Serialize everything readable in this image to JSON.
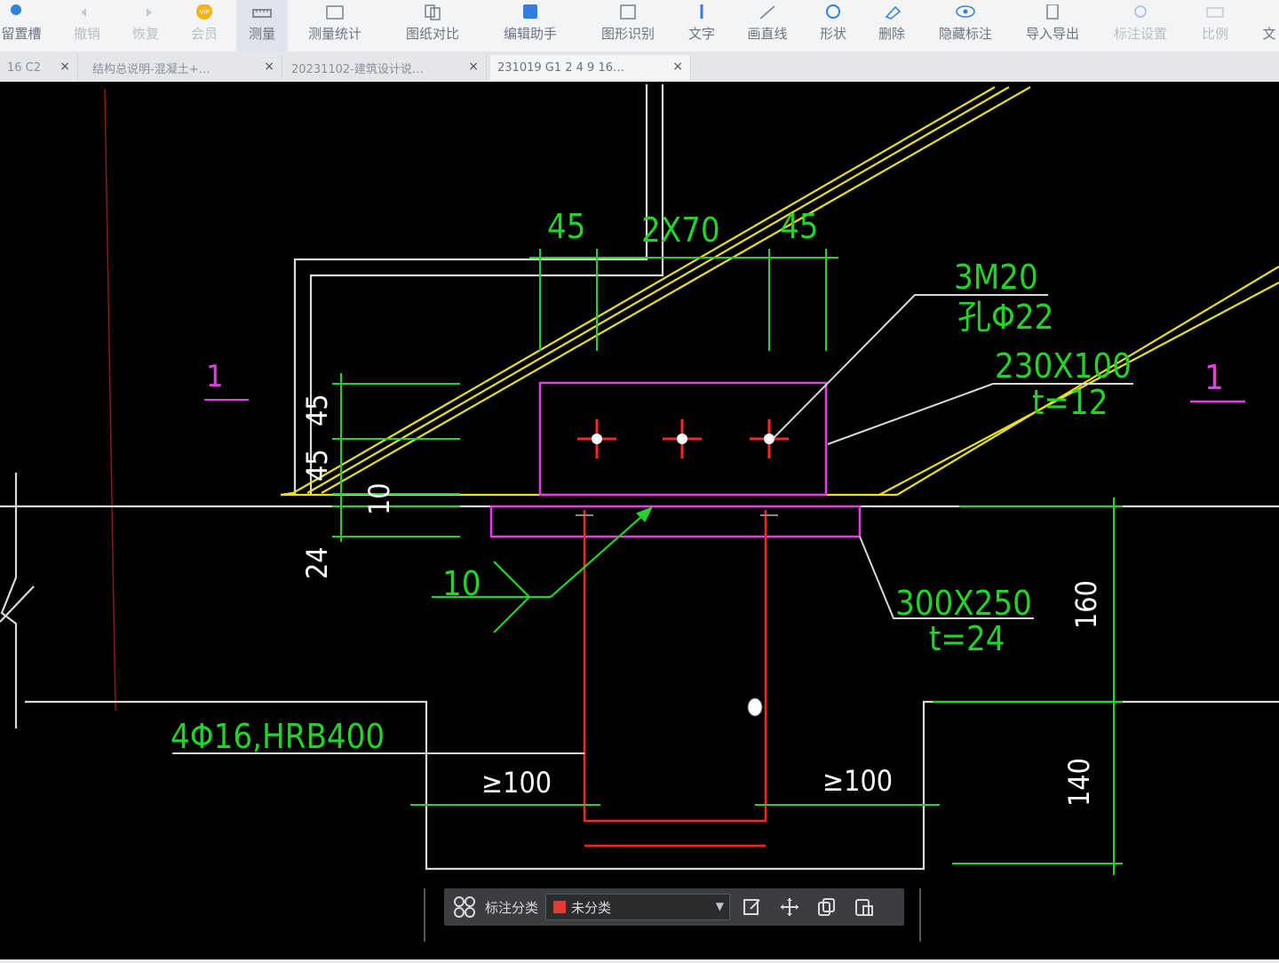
{
  "toolbar": {
    "items": [
      {
        "label": "留置槽",
        "icon": "drop-icon"
      },
      {
        "label": "撤销",
        "icon": "undo-icon"
      },
      {
        "label": "恢复",
        "icon": "redo-icon"
      },
      {
        "label": "会员",
        "icon": "vip-icon",
        "badge": "VIP"
      },
      {
        "label": "测量",
        "icon": "ruler-icon"
      },
      {
        "label": "测量统计",
        "icon": "measure-stats-icon"
      },
      {
        "label": "图纸对比",
        "icon": "compare-icon"
      },
      {
        "label": "编辑助手",
        "icon": "edit-assistant-icon"
      },
      {
        "label": "图形识别",
        "icon": "shape-recognize-icon"
      },
      {
        "label": "文字",
        "icon": "text-icon"
      },
      {
        "label": "画直线",
        "icon": "line-icon"
      },
      {
        "label": "形状",
        "icon": "shape-icon"
      },
      {
        "label": "删除",
        "icon": "eraser-icon"
      },
      {
        "label": "隐藏标注",
        "icon": "eye-icon"
      },
      {
        "label": "导入导出",
        "icon": "import-export-icon"
      },
      {
        "label": "标注设置",
        "icon": "annotation-settings-icon"
      },
      {
        "label": "比例",
        "icon": "scale-icon"
      },
      {
        "label": "文",
        "icon": "more-icon"
      }
    ]
  },
  "tabs": [
    {
      "label": "16 C2"
    },
    {
      "label": "结构总说明-混凝土+…"
    },
    {
      "label": "20231102-建筑设计说…"
    },
    {
      "label": "231019 G1 2 4 9 16…"
    }
  ],
  "drawing": {
    "dim_top_left": "45",
    "dim_top_mid": "2X70",
    "dim_top_right": "45",
    "dim_left_45a": "45",
    "dim_left_45b": "45",
    "dim_left_10": "10",
    "dim_left_24": "24",
    "bolt_label": "3M20",
    "hole_label": "孔Φ22",
    "plate_small_size": "230X100",
    "plate_small_t": "t=12",
    "plate_large_size": "300X250",
    "plate_large_t": "t=24",
    "weld_size": "10",
    "rebar_label": "4Φ16,HRB400",
    "min_left": "≥100",
    "min_right": "≥100",
    "dim_160": "160",
    "dim_140": "140",
    "section_left": "1",
    "section_right": "1"
  },
  "bottombar": {
    "category_label": "标注分类",
    "category_value": "未分类",
    "category_color": "#e53a2f"
  },
  "colors": {
    "cad_green": "#22d32c",
    "cad_yellow": "#e8e21a",
    "cad_magenta": "#e23ee0",
    "cad_red": "#ff2424",
    "cad_white": "#d9d9d9"
  }
}
